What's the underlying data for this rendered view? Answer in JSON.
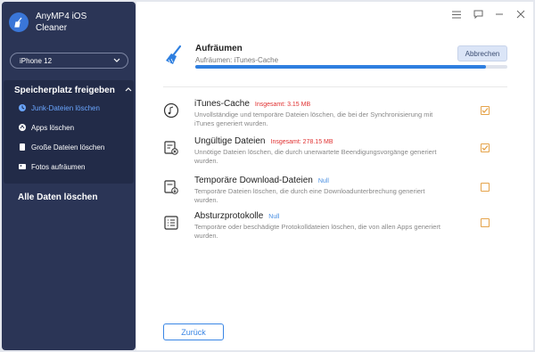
{
  "app": {
    "title_line1": "AnyMP4 iOS",
    "title_line2": "Cleaner"
  },
  "device": {
    "selected": "iPhone 12"
  },
  "sidebar": {
    "section_title": "Speicherplatz freigeben",
    "items": [
      {
        "label": "Junk-Dateien löschen",
        "icon": "clock-icon",
        "active": true
      },
      {
        "label": "Apps löschen",
        "icon": "app-icon",
        "active": false
      },
      {
        "label": "Große Dateien löschen",
        "icon": "file-icon",
        "active": false
      },
      {
        "label": "Fotos aufräumen",
        "icon": "photo-icon",
        "active": false
      }
    ],
    "delete_all": "Alle Daten löschen"
  },
  "task": {
    "title": "Aufräumen",
    "status": "Aufräumen: iTunes-Cache",
    "progress": 0.93,
    "cancel_label": "Abbrechen"
  },
  "categories": [
    {
      "name": "iTunes-Cache",
      "size": "Insgesamt: 3.15 MB",
      "size_is_null": false,
      "desc": "Unvollständige und temporäre Dateien löschen, die bei der Synchronisierung mit iTunes generiert wurden.",
      "checked": true
    },
    {
      "name": "Ungültige Dateien",
      "size": "Insgesamt: 278.15 MB",
      "size_is_null": false,
      "desc": "Unnötige Dateien löschen, die durch unerwartete Beendigungsvorgänge generiert wurden.",
      "checked": true
    },
    {
      "name": "Temporäre Download-Dateien",
      "size": "Null",
      "size_is_null": true,
      "desc": "Temporäre Dateien löschen, die durch eine Downloadunterbrechung generiert wurden.",
      "checked": false
    },
    {
      "name": "Absturzprotokolle",
      "size": "Null",
      "size_is_null": true,
      "desc": "Temporäre oder beschädigte Protokolldateien löschen, die von allen Apps generiert wurden.",
      "checked": false
    }
  ],
  "footer": {
    "back_label": "Zurück"
  },
  "colors": {
    "sidebar_bg": "#2b3556",
    "accent": "#2e7fe0",
    "checkbox": "#e5a34a",
    "size_red": "#e03030"
  }
}
